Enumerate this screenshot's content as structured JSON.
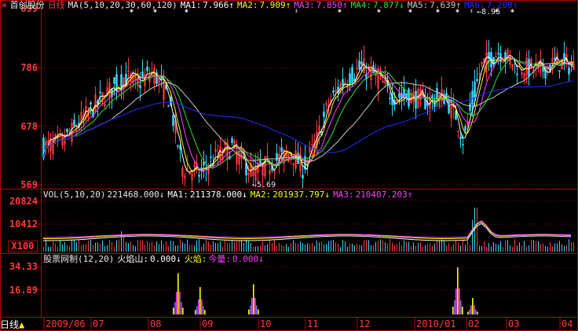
{
  "colors": {
    "background": "#000000",
    "frame": "#b40000",
    "price_axis": "#ff3b3b",
    "up": "#ff3b3b",
    "down": "#39d6ff",
    "ma1": "#ffffff",
    "ma2": "#ffff00",
    "ma3": "#ff40ff",
    "ma4": "#28e628",
    "ma5": "#c8c8c8",
    "ma6": "#2030ff",
    "vol_ma1": "#ffffff",
    "vol_ma2": "#ffff00",
    "vol_ma3": "#ff40ff",
    "hot_spike": "#ffff00"
  },
  "header": {
    "icon": "stock-icon",
    "stock_name": "首创股份",
    "period": "日线",
    "ma_params": "MA(5,10,20,30,60,120)",
    "ma1_label": "MA1:",
    "ma1_value": "7.966↑",
    "ma2_label": "MA2:",
    "ma2_value": "7.909↑",
    "ma3_label": "MA3:",
    "ma3_value": "7.850↑",
    "ma4_label": "MA4:",
    "ma4_value": "7.877↓",
    "ma5_label": "MA5:",
    "ma5_value": "7.639↑",
    "ma6_label": "MA6:",
    "ma6_value": "7.200↑"
  },
  "price_axis": {
    "tick_899": "899",
    "tick_786": "786",
    "tick_678": "678",
    "tick_569": "569"
  },
  "price_annotations": {
    "high": "←8.95",
    "low": "←5.69"
  },
  "volume_header": {
    "params": "VOL(5,10,20)",
    "vol": "221468.000↓",
    "ma1_label": "MA1:",
    "ma1": "211378.000↓",
    "ma2_label": "MA2:",
    "ma2": "201937.797↓",
    "ma3_label": "MA3:",
    "ma3": "210407.203↑"
  },
  "volume_axis": {
    "tick_top": "20824",
    "tick_mid": "10412",
    "unit": "X100"
  },
  "indicator_header": {
    "name": "股票网制(12,20)",
    "hot_label": "火焰山:",
    "hot_value": "0.000↓",
    "fire_label": "火焰:",
    "today_label": "今量:",
    "today_value": "0.000↓"
  },
  "indicator_axis": {
    "tick_top": "34.33",
    "tick_mid": "16.89"
  },
  "bottom_bar": {
    "period_tab": "日线",
    "date_labels": [
      "2009/06",
      "07",
      "08",
      "09",
      "10",
      "11",
      "12",
      "2010/01",
      "02",
      "03",
      "04"
    ]
  },
  "chart_data": {
    "type": "candlestick",
    "price_range": [
      569,
      899
    ],
    "price_unit_note": "",
    "annotated_high": 8.95,
    "annotated_low": 5.69,
    "spike_values": [
      [
        4,
        30
      ],
      [
        3,
        20
      ],
      [
        3,
        22
      ],
      [
        6,
        34.33
      ],
      [
        2,
        12
      ]
    ]
  }
}
